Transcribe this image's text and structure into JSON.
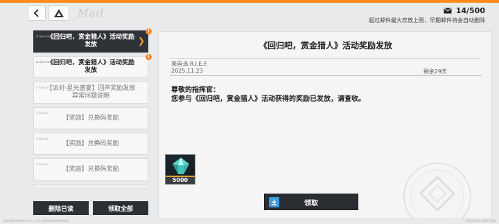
{
  "header": {
    "logo_text": "Mail",
    "mail_count": "14/500",
    "mail_note": "超过邮件最大存放上限，早期邮件将会自动删除",
    "icons": {
      "back": "chevron-left-icon",
      "home": "triangle-home-icon",
      "mail": "envelope-icon"
    }
  },
  "accent_color": "#ff8c1a",
  "mail_list": {
    "items": [
      {
        "tag": "A.Special",
        "title": "《回归吧，赏金猎人》活动奖励发放",
        "active": true,
        "unread": true
      },
      {
        "tag": "A.Special",
        "title": "《回归吧，赏金猎人》活动奖励发放",
        "active": false,
        "unread": true
      },
      {
        "tag": "A.Special",
        "title": "【派对·星光盛宴】回声奖励发放异常问题说明",
        "active": false,
        "unread": false
      },
      {
        "tag": "A.Special",
        "title": "【奖励】兑换码奖励",
        "active": false,
        "unread": false
      },
      {
        "tag": "A.Special",
        "title": "【奖励】兑换码奖励",
        "active": false,
        "unread": false
      },
      {
        "tag": "A.Special",
        "title": "【奖励】兑换码奖励",
        "active": false,
        "unread": false
      }
    ],
    "badge": "!",
    "delete_read_label": "删除已读",
    "claim_all_label": "领取全部"
  },
  "mail_detail": {
    "title": "《回归吧，赏金猎人》活动奖励发放",
    "from": "来自:B.R.I.E.F.",
    "date": "2025.11.23",
    "remaining": "剩余29天",
    "greeting": "尊敬的指挥官：",
    "body": "您参与《回归吧，赏金猎人》活动获得的奖励已发放，请查收。",
    "reward": {
      "icon": "crystal-gem-icon",
      "quantity": "5000"
    },
    "claim_label": "领取"
  },
  "footer": {
    "left": "UID:0000000000  Ver. 1.0.0 0000000000000000",
    "right": "0000 0000 0000 0000"
  }
}
